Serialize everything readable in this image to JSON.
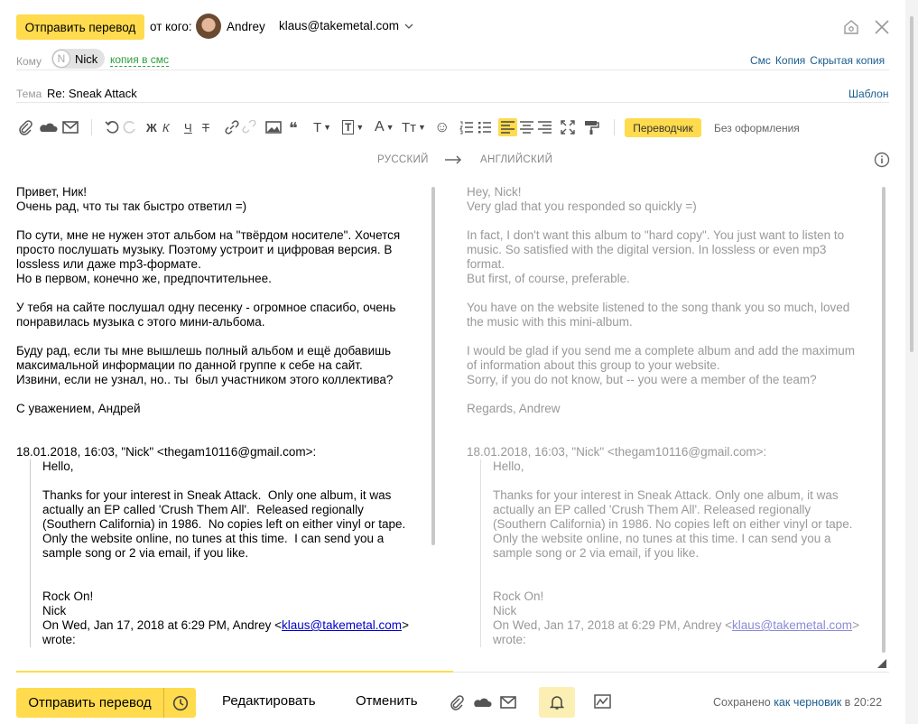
{
  "header": {
    "send_label": "Отправить перевод",
    "from_label": "от кого:",
    "sender_name": "Andrey",
    "sender_email": "klaus@takemetal.com"
  },
  "to": {
    "label": "Кому",
    "recipient": "Nick",
    "recipient_initial": "N",
    "copy_sms": "копия в смс",
    "links": [
      "Смс",
      "Копия",
      "Скрытая копия"
    ]
  },
  "subject": {
    "label": "Тема",
    "value": "Re: Sneak Attack",
    "template": "Шаблон"
  },
  "toolbar": {
    "translator_label": "Переводчик",
    "plain_label": "Без оформления",
    "bold": "Ж",
    "italic": "К",
    "underline": "Ч",
    "strike": "Т"
  },
  "translate": {
    "from_lang": "РУССКИЙ",
    "to_lang": "АНГЛИЙСКИЙ"
  },
  "original": {
    "body": "Привет, Ник!\nОчень рад, что ты так быстро ответил =)\n\nПо сути, мне не нужен этот альбом на \"твёрдом носителе\". Хочется\nпросто послушать музыку. Поэтому устроит и цифровая версия. В\nlossless или даже mp3-формате.\nНо в первом, конечно же, предпочтительнее.\n\nУ тебя на сайте послушал одну песенку - огромное спасибо, очень\nпонравилась музыка с этого мини-альбома.\n\nБуду рад, если ты мне вышлешь полный альбом и ещё добавишь\nмаксимальной информации по данной группе к себе на сайт.\nИзвини, если не узнал, но.. ты  был участником этого коллектива?\n\nС уважением, Андрей",
    "quote_header": "18.01.2018, 16:03, \"Nick\" <thegam10116@gmail.com>:",
    "quote_body": "Hello,\n\nThanks for your interest in Sneak Attack.  Only one album, it was\nactually an EP called 'Crush Them All'.  Released regionally\n(Southern California) in 1986.  No copies left on either vinyl or tape.\nOnly the website online, no tunes at this time.  I can send you a\nsample song or 2 via email, if you like.\n\n\nRock On!\nNick\n",
    "quote_wrote_pre": "On Wed, Jan 17, 2018 at 6:29 PM, Andrey <",
    "quote_email": "klaus@takemetal.com",
    "quote_wrote_post": ">",
    "quote_wrote_line2": "wrote:"
  },
  "translation": {
    "body": "Hey, Nick!\nVery glad that you responded so quickly =)\n\nIn fact, I don't want this album to \"hard copy\". You just want to listen to\nmusic. So satisfied with the digital version. In lossless or even mp3\nformat.\nBut first, of course, preferable.\n\nYou have on the website listened to the song thank you so much, loved\nthe music with this mini-album.\n\nI would be glad if you send me a complete album and add the maximum\nof information about this group to your website.\nSorry, if you do not know, but -- you were a member of the team?\n\nRegards, Andrew",
    "quote_header": "18.01.2018, 16:03, \"Nick\" <thegam10116@gmail.com>:",
    "quote_body": "Hello,\n\nThanks for your interest in Sneak Attack. Only one album, it was\nactually an EP called 'Crush Them All'. Released regionally\n(Southern California) in 1986. No copies left on either vinyl or tape.\nOnly the website online, no tunes at this time. I can send you a\nsample song or 2 via email, if you like.\n\n\nRock On!\nNick\n",
    "quote_wrote_pre": "On Wed, Jan 17, 2018 at 6:29 PM, Andrey <",
    "quote_email": "klaus@takemetal.com",
    "quote_wrote_post": ">",
    "quote_wrote_line2": "wrote:"
  },
  "footer": {
    "send_label": "Отправить перевод",
    "edit_label": "Редактировать",
    "cancel_label": "Отменить",
    "saved_pre": "Сохранено",
    "saved_link": "как черновик",
    "saved_post": "в 20:22"
  },
  "colors": {
    "accent": "#ffdb4d",
    "link": "#1a5d8f",
    "green": "#2b9e3a"
  }
}
